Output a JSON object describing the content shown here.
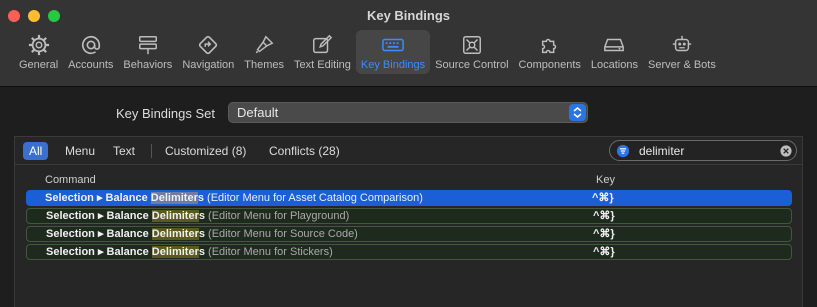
{
  "window": {
    "title": "Key Bindings",
    "lights": [
      "#ff5f57",
      "#febc2e",
      "#28c840"
    ]
  },
  "toolbar": [
    {
      "label": "General",
      "icon": "gear-icon"
    },
    {
      "label": "Accounts",
      "icon": "at-icon"
    },
    {
      "label": "Behaviors",
      "icon": "behaviors-icon"
    },
    {
      "label": "Navigation",
      "icon": "navigation-icon"
    },
    {
      "label": "Themes",
      "icon": "brush-icon"
    },
    {
      "label": "Text Editing",
      "icon": "pencil-square-icon"
    },
    {
      "label": "Key Bindings",
      "icon": "keyboard-icon",
      "selected": true
    },
    {
      "label": "Source Control",
      "icon": "source-control-icon"
    },
    {
      "label": "Components",
      "icon": "puzzle-icon"
    },
    {
      "label": "Locations",
      "icon": "drive-icon"
    },
    {
      "label": "Server & Bots",
      "icon": "robot-icon"
    }
  ],
  "key_bindings_set": {
    "label": "Key Bindings Set",
    "value": "Default"
  },
  "filters": {
    "all": "All",
    "menu": "Menu",
    "text": "Text",
    "customized": "Customized (8)",
    "conflicts": "Conflicts (28)",
    "selected": "All"
  },
  "search": {
    "value": "delimiter"
  },
  "columns": {
    "command": "Command",
    "key": "Key"
  },
  "rows": [
    {
      "pre": "Selection ▸ Balance ",
      "match": "Delimiter",
      "post": "s",
      "context": " (Editor Menu for Asset Catalog Comparison)",
      "key": "^⌘}",
      "selected": true,
      "conflict": false
    },
    {
      "pre": "Selection ▸ Balance ",
      "match": "Delimiter",
      "post": "s",
      "context": " (Editor Menu for Playground)",
      "key": "^⌘}",
      "selected": false,
      "conflict": true
    },
    {
      "pre": "Selection ▸ Balance ",
      "match": "Delimiter",
      "post": "s",
      "context": " (Editor Menu for Source Code)",
      "key": "^⌘}",
      "selected": false,
      "conflict": true
    },
    {
      "pre": "Selection ▸ Balance ",
      "match": "Delimiter",
      "post": "s",
      "context": " (Editor Menu for Stickers)",
      "key": "^⌘}",
      "selected": false,
      "conflict": true
    }
  ],
  "colors": {
    "accent": "#3d8bfd",
    "selection": "#1a5fd6",
    "conflict_border": "#3e5a3a"
  }
}
